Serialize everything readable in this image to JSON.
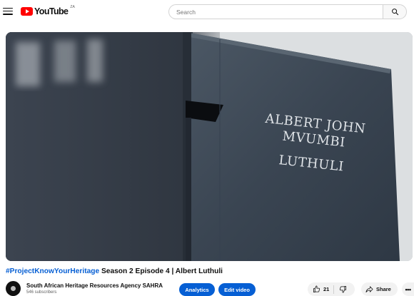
{
  "masthead": {
    "menu_icon": "hamburger-menu-icon",
    "logo_text": "YouTube",
    "logo_country": "ZA",
    "logo_color": "#ff0000",
    "search_placeholder": "Search",
    "search_icon": "search-icon"
  },
  "player": {
    "thumbnail_inscription": [
      "ALBERT JOHN",
      "MVUMBI",
      "LUTHULI"
    ],
    "blurred_text": "ULI"
  },
  "video": {
    "title_hashtag": "#ProjectKnowYourHeritage",
    "title_rest": " Season 2 Episode 4 | Albert Luthuli",
    "hashtag_color": "#065fd4"
  },
  "channel": {
    "name": "South African Heritage Resources Agency SAHRA",
    "subscribers": "546 subscribers"
  },
  "actions": {
    "analytics_label": "Analytics",
    "edit_video_label": "Edit video",
    "like_count": "21",
    "share_label": "Share",
    "more_label": "•••",
    "accent_color": "#065fd4"
  }
}
